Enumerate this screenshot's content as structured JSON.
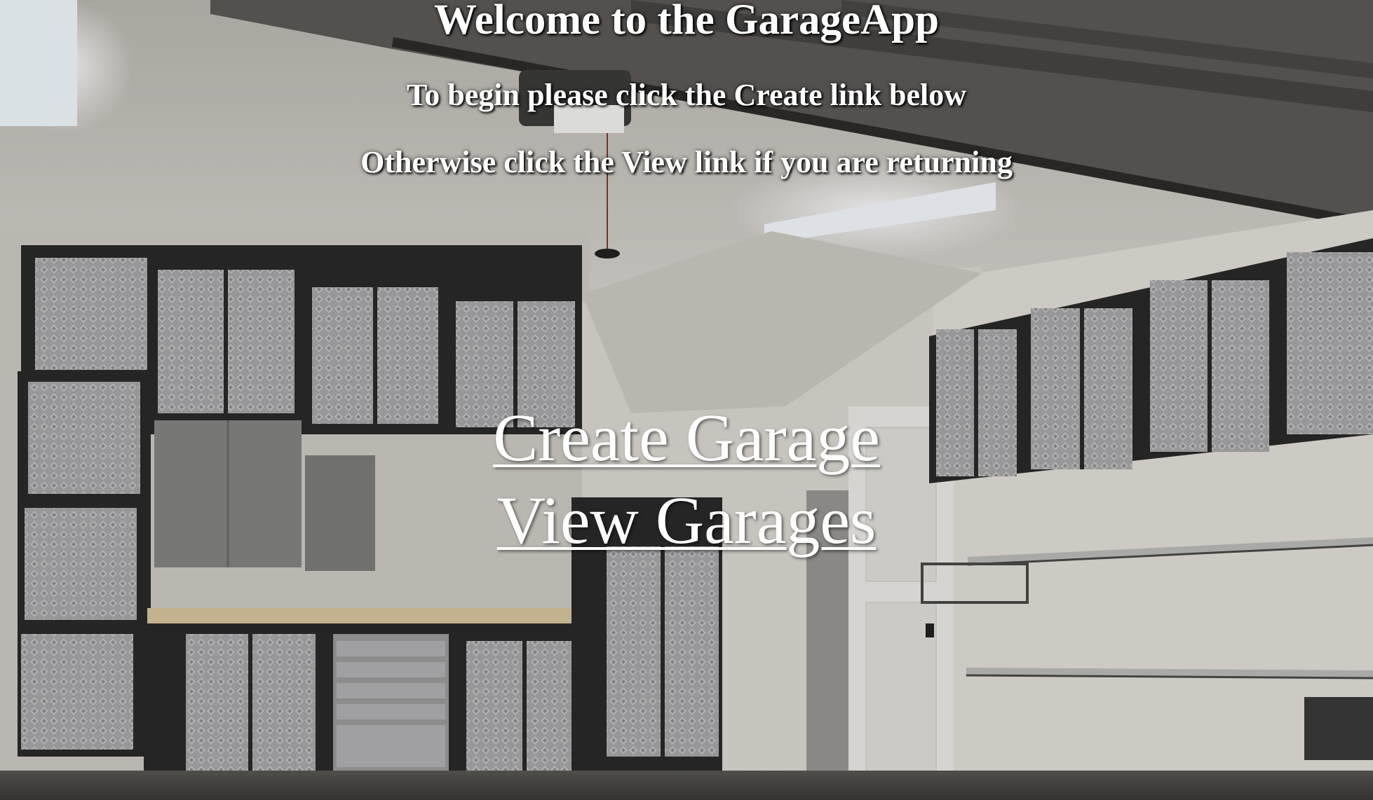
{
  "header": {
    "title": "Welcome to the GarageApp",
    "line1": "To begin please click the Create link below",
    "line2": "Otherwise click the View link if you are returning"
  },
  "links": {
    "create": "Create Garage",
    "view": "View Garages"
  },
  "colors": {
    "text": "#ffffff",
    "ceiling": "#d9d6d0",
    "wall": "#d6d3cc",
    "cabinet_frame": "#2b2b2b",
    "cabinet_panel": "#a7a7a9"
  }
}
